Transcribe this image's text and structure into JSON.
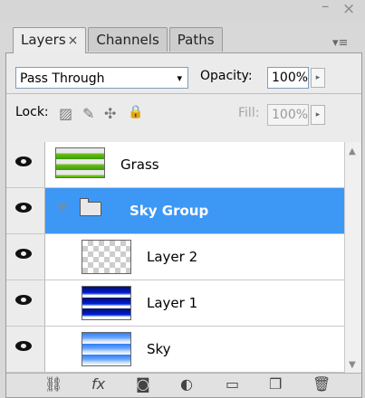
{
  "window": {
    "minimize_glyph": "–",
    "close_glyph": "×",
    "panel_menu_glyph": "▾≡"
  },
  "tabs": [
    {
      "label": "Layers",
      "close": "×",
      "active": true
    },
    {
      "label": "Channels",
      "active": false
    },
    {
      "label": "Paths",
      "active": false
    }
  ],
  "blend_mode": {
    "value": "Pass Through",
    "caret": "▾"
  },
  "opacity": {
    "label": "Opacity:",
    "value": "100%",
    "step": "▸"
  },
  "lock": {
    "label": "Lock:",
    "icons": [
      {
        "name": "lock-transparent-pixels-icon",
        "glyph": "▨"
      },
      {
        "name": "lock-image-pixels-icon",
        "glyph": "✎"
      },
      {
        "name": "lock-position-icon",
        "glyph": "✣"
      },
      {
        "name": "lock-all-icon",
        "glyph": "🔒"
      }
    ]
  },
  "fill": {
    "label": "Fill:",
    "value": "100%",
    "step": "▸"
  },
  "layers": [
    {
      "name": "Grass",
      "thumb": "grass",
      "bold": false,
      "selected": false
    },
    {
      "name": "Sky Group",
      "thumb": "folder",
      "bold": true,
      "selected": true
    },
    {
      "name": "Layer 2",
      "thumb": "transparent",
      "bold": false,
      "selected": false
    },
    {
      "name": "Layer 1",
      "thumb": "layer1",
      "bold": false,
      "selected": false
    },
    {
      "name": "Sky",
      "thumb": "sky",
      "bold": false,
      "selected": false
    }
  ],
  "scrollbar": {
    "up": "▲",
    "down": "▼"
  },
  "bottom_tools": [
    {
      "name": "link-layers-icon",
      "glyph": "⛓"
    },
    {
      "name": "layer-style-icon",
      "glyph": "fx"
    },
    {
      "name": "add-mask-icon",
      "glyph": "◙"
    },
    {
      "name": "adjustment-layer-icon",
      "glyph": "◐"
    },
    {
      "name": "new-group-icon",
      "glyph": "▭"
    },
    {
      "name": "new-layer-icon",
      "glyph": "❐"
    },
    {
      "name": "delete-layer-icon",
      "glyph": "🗑"
    }
  ],
  "colors": {
    "selection": "#3d98f5",
    "panel_bg": "#ebebeb"
  }
}
